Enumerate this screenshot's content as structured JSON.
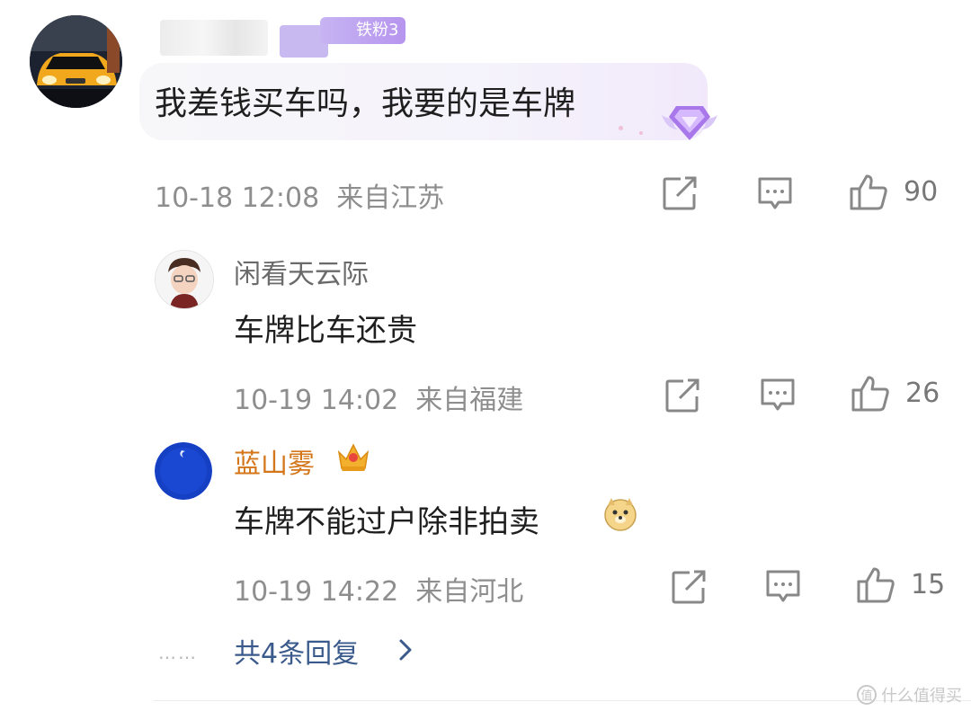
{
  "comment": {
    "fan_badge": "铁粉3",
    "text": "我差钱买车吗，我要的是车牌",
    "time": "10-18 12:08",
    "location": "来自江苏",
    "likes": "90"
  },
  "replies": [
    {
      "user": "闲看天云际",
      "text": "车牌比车还贵",
      "time": "10-19 14:02",
      "location": "来自福建",
      "likes": "26"
    },
    {
      "user": "蓝山雾",
      "text": "车牌不能过户除非拍卖",
      "time": "10-19 14:22",
      "location": "来自河北",
      "likes": "15"
    }
  ],
  "more_replies": {
    "dots": "……",
    "label": "共4条回复"
  },
  "watermark": "什么值得买",
  "colors": {
    "badge": "#b695ee",
    "vip_name": "#d4761a",
    "link": "#3a5a8c"
  }
}
